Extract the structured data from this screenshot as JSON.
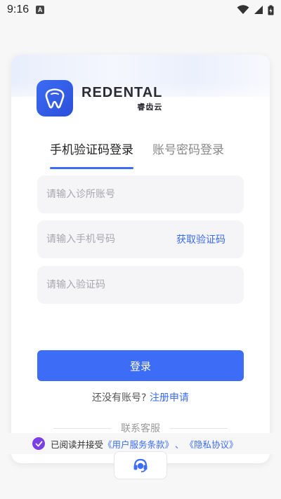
{
  "status_bar": {
    "time": "9:16",
    "notification": "A"
  },
  "brand": {
    "name_en": "REDENTAL",
    "name_cn": "睿齿云"
  },
  "tabs": [
    {
      "label": "手机验证码登录",
      "active": true
    },
    {
      "label": "账号密码登录",
      "active": false
    }
  ],
  "form": {
    "clinic_placeholder": "请输入诊所账号",
    "phone_placeholder": "请输入手机号码",
    "get_code_label": "获取验证码",
    "code_placeholder": "请输入验证码"
  },
  "login_label": "登录",
  "register": {
    "prompt": "还没有账号?",
    "link": "注册申请"
  },
  "contact_label": "联系客服",
  "agreement": {
    "checked": true,
    "prefix": "已阅读并接受",
    "terms": "《用户服务条款》",
    "sep": "、",
    "privacy": "《隐私协议》"
  },
  "colors": {
    "accent": "#3d6df6",
    "check": "#7b3fe4"
  },
  "icons": {
    "logo": "tooth-logo-icon",
    "support": "headset-icon"
  }
}
